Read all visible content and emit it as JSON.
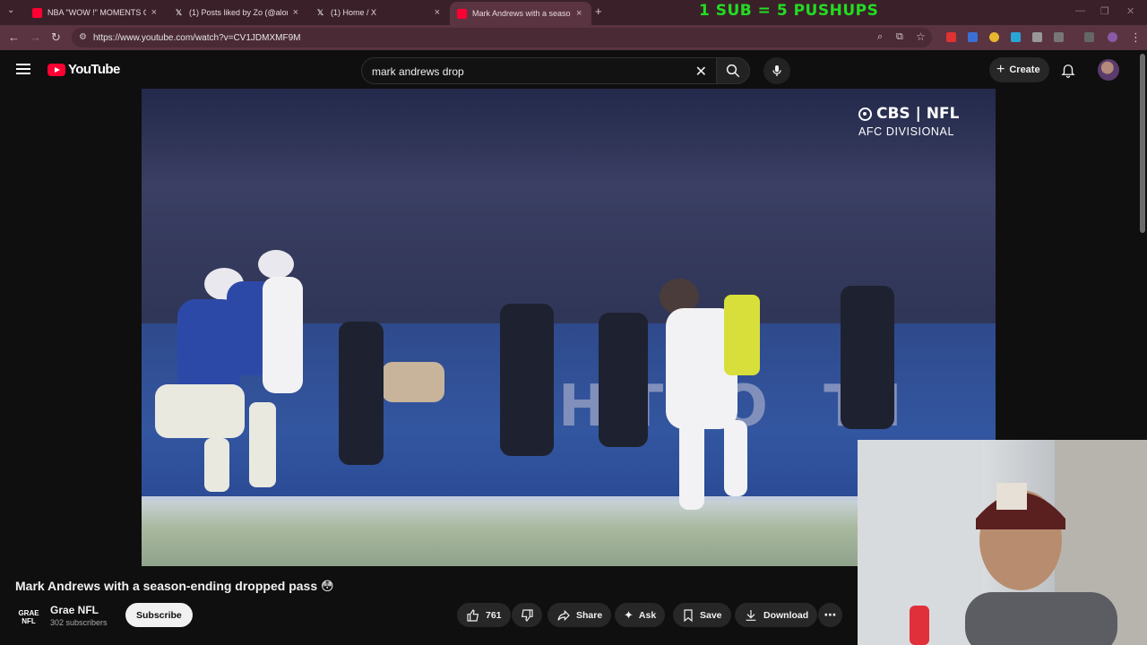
{
  "browser": {
    "tabs": [
      {
        "label": "NBA \"WOW !\" MOMENTS OF 2…",
        "icon": "youtube-icon",
        "active": false
      },
      {
        "label": "(1) Posts liked by Zo (@alonzo…",
        "icon": "x-icon",
        "active": false
      },
      {
        "label": "(1) Home / X",
        "icon": "x-icon",
        "active": false
      },
      {
        "label": "Mark Andrews with a season-e…",
        "icon": "youtube-icon",
        "active": true
      }
    ],
    "new_tab": "+",
    "overlay_banner": "1 SUB = 5 PUSHUPS",
    "url": "https://www.youtube.com/watch?v=CV1JDMXMF9M"
  },
  "header": {
    "logo_text": "YouTube",
    "search_value": "mark andrews drop",
    "create_label": "Create"
  },
  "player": {
    "broadcaster": "CBS | NFL",
    "game_label": "AFC DIVISIONAL",
    "wall_text": "HT O TI"
  },
  "video": {
    "title": "Mark Andrews with a season-ending dropped pass 😳",
    "channel_avatar": "GRAE NFL",
    "channel_name": "Grae NFL",
    "subscribers": "302 subscribers",
    "subscribe_label": "Subscribe",
    "likes": "761",
    "share_label": "Share",
    "ask_label": "Ask",
    "save_label": "Save",
    "download_label": "Download"
  },
  "colors": {
    "accent": "#ff0033",
    "banner": "#22dd22",
    "tab_bar": "#3a2129"
  }
}
